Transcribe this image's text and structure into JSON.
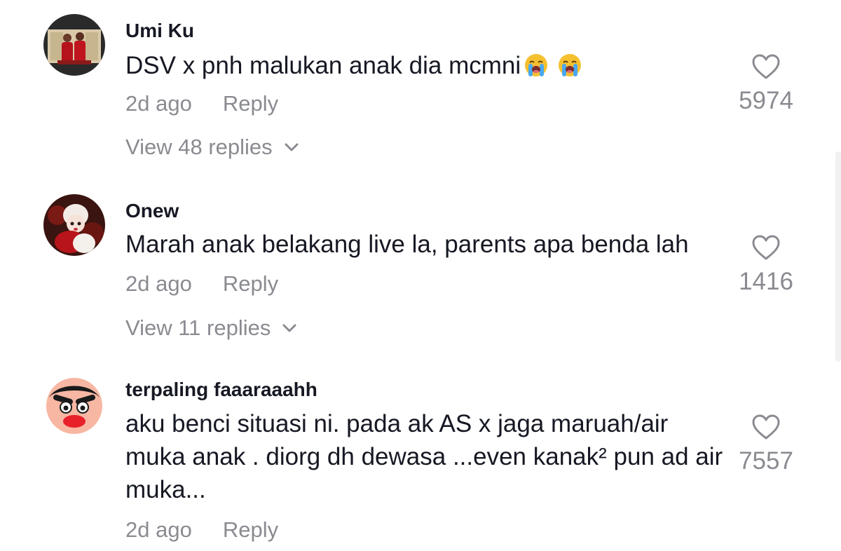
{
  "comments": [
    {
      "username": "Umi Ku",
      "text": "DSV x pnh malukan anak dia mcmni",
      "emoji": [
        "loudly-crying-face-icon",
        "loudly-crying-face-icon"
      ],
      "time": "2d ago",
      "reply_label": "Reply",
      "likes": "5974",
      "view_replies": "View 48 replies"
    },
    {
      "username": "Onew",
      "text": "Marah anak belakang live la, parents apa benda lah",
      "emoji": [],
      "time": "2d ago",
      "reply_label": "Reply",
      "likes": "1416",
      "view_replies": "View 11 replies"
    },
    {
      "username": "terpaling faaaraaahh",
      "text": "aku benci situasi ni. pada ak AS x jaga maruah/air muka anak . diorg dh dewasa ...even kanak² pun ad air muka...",
      "emoji": [],
      "time": "2d ago",
      "reply_label": "Reply",
      "likes": "7557"
    }
  ],
  "colors": {
    "text_primary": "#161823",
    "text_secondary": "#8a8b91",
    "background": "#ffffff"
  },
  "icons": {
    "like": "heart-outline-icon",
    "expand": "chevron-down-icon"
  }
}
